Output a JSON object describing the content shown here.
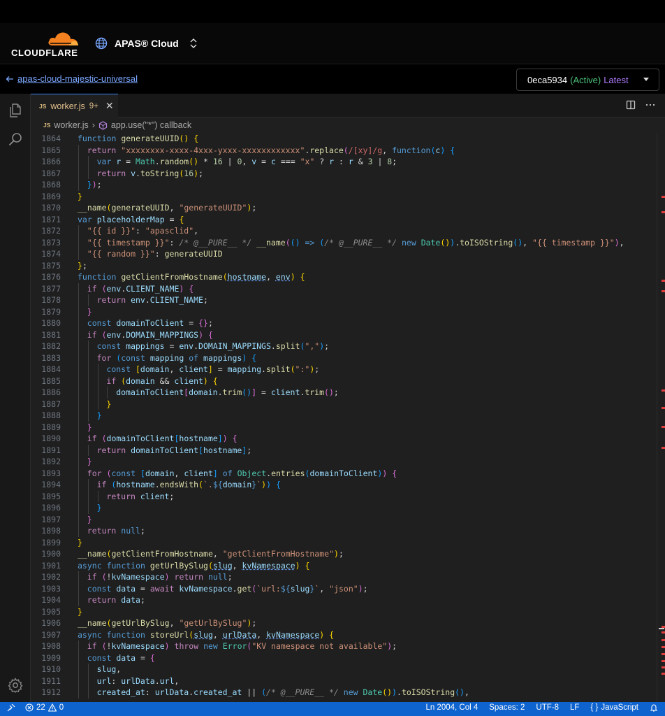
{
  "header": {
    "logo_text": "CLOUDFLARE",
    "app_name": "APAS® Cloud"
  },
  "subheader": {
    "back_label": "apas-cloud-majestic-universal",
    "version": {
      "hash": "0eca5934",
      "status": "(Active)",
      "tag": "Latest"
    }
  },
  "tab": {
    "badge": "JS",
    "name": "worker.js",
    "problems": "9+"
  },
  "breadcrumb": {
    "badge": "JS",
    "file": "worker.js",
    "symbol": "app.use(\"*\") callback"
  },
  "status": {
    "errors": "22",
    "warnings": "0",
    "position": "Ln 2004, Col 4",
    "spaces": "Spaces: 2",
    "encoding": "UTF-8",
    "eol": "LF",
    "language": "JavaScript"
  },
  "code": {
    "lines": [
      {
        "n": "1864",
        "i": 0,
        "h": "<span class=\"kw\">function</span> <span class=\"fn\">generateUUID</span><span class=\"bra1\">()</span> <span class=\"bra1\">{</span>"
      },
      {
        "n": "1865",
        "i": 1,
        "h": "<span class=\"ctl\">return</span> <span class=\"str\">\"xxxxxxxx-xxxx-4xxx-yxxx-xxxxxxxxxxxx\"</span>.<span class=\"fn\">replace</span><span class=\"bra2\">(</span><span class=\"rx\">/[xy]/g</span>, <span class=\"kw\">function</span><span class=\"bra3\">(</span><span class=\"var\">c</span><span class=\"bra3\">)</span> <span class=\"bra3\">{</span>"
      },
      {
        "n": "1866",
        "i": 2,
        "h": "<span class=\"kw\">var</span> <span class=\"var\">r</span> = <span class=\"typ\">Math</span>.<span class=\"fn\">random</span><span class=\"bra1\">()</span> * <span class=\"num\">16</span> | <span class=\"num\">0</span>, <span class=\"var\">v</span> = <span class=\"var\">c</span> === <span class=\"str\">\"x\"</span> ? <span class=\"var\">r</span> : <span class=\"var\">r</span> &amp; <span class=\"num\">3</span> | <span class=\"num\">8</span>;"
      },
      {
        "n": "1867",
        "i": 2,
        "h": "<span class=\"ctl\">return</span> <span class=\"var\">v</span>.<span class=\"fn\">toString</span><span class=\"bra1\">(</span><span class=\"num\">16</span><span class=\"bra1\">)</span>;"
      },
      {
        "n": "1868",
        "i": 1,
        "h": "<span class=\"bra3\">}</span><span class=\"bra2\">)</span>;"
      },
      {
        "n": "1869",
        "i": 0,
        "h": "<span class=\"bra1\">}</span>"
      },
      {
        "n": "1870",
        "i": 0,
        "h": "<span class=\"fn\">__name</span><span class=\"bra1\">(</span><span class=\"fn\">generateUUID</span>, <span class=\"str\">\"generateUUID\"</span><span class=\"bra1\">)</span>;"
      },
      {
        "n": "1871",
        "i": 0,
        "h": "<span class=\"kw\">var</span> <span class=\"var\">placeholderMap</span> = <span class=\"bra1\">{</span>"
      },
      {
        "n": "1872",
        "i": 1,
        "h": "<span class=\"str\">\"{{ id }}\"</span>: <span class=\"str\">\"apasclid\"</span>,"
      },
      {
        "n": "1873",
        "i": 1,
        "h": "<span class=\"str\">\"{{ timestamp }}\"</span>: <span class=\"cmt\">/* @__PURE__ */</span> <span class=\"fn\">__name</span><span class=\"bra2\">(</span><span class=\"bra3\">()</span> <span class=\"kw\">=&gt;</span> <span class=\"bra3\">(</span><span class=\"cmt\">/* @__PURE__ */</span> <span class=\"kw\">new</span> <span class=\"typ\">Date</span><span class=\"bra1\">()</span><span class=\"bra3\">)</span>.<span class=\"fn\">toISOString</span><span class=\"bra3\">()</span>, <span class=\"str\">\"{{ timestamp }}\"</span><span class=\"bra2\">)</span>,"
      },
      {
        "n": "1874",
        "i": 1,
        "h": "<span class=\"str\">\"{{ random }}\"</span>: <span class=\"fn\">generateUUID</span>"
      },
      {
        "n": "1875",
        "i": 0,
        "h": "<span class=\"bra1\">}</span>;"
      },
      {
        "n": "1876",
        "i": 0,
        "h": "<span class=\"kw\">function</span> <span class=\"fn\">getClientFromHostname</span><span class=\"bra1\">(</span><span class=\"var sq\">hostname</span>, <span class=\"var sq\">env</span><span class=\"bra1\">)</span> <span class=\"bra1\">{</span>"
      },
      {
        "n": "1877",
        "i": 1,
        "h": "<span class=\"ctl\">if</span> <span class=\"bra2\">(</span><span class=\"var\">env</span>.<span class=\"var\">CLIENT_NAME</span><span class=\"bra2\">)</span> <span class=\"bra2\">{</span>"
      },
      {
        "n": "1878",
        "i": 2,
        "h": "<span class=\"ctl\">return</span> <span class=\"var\">env</span>.<span class=\"var\">CLIENT_NAME</span>;"
      },
      {
        "n": "1879",
        "i": 1,
        "h": "<span class=\"bra2\">}</span>"
      },
      {
        "n": "1880",
        "i": 1,
        "h": "<span class=\"kw\">const</span> <span class=\"var\">domainToClient</span> = <span class=\"bra2\">{}</span>;"
      },
      {
        "n": "1881",
        "i": 1,
        "h": "<span class=\"ctl\">if</span> <span class=\"bra2\">(</span><span class=\"var\">env</span>.<span class=\"var\">DOMAIN_MAPPINGS</span><span class=\"bra2\">)</span> <span class=\"bra2\">{</span>"
      },
      {
        "n": "1882",
        "i": 2,
        "h": "<span class=\"kw\">const</span> <span class=\"var\">mappings</span> = <span class=\"var\">env</span>.<span class=\"var\">DOMAIN_MAPPINGS</span>.<span class=\"fn\">split</span><span class=\"bra3\">(</span><span class=\"str\">\",\"</span><span class=\"bra3\">)</span>;"
      },
      {
        "n": "1883",
        "i": 2,
        "h": "<span class=\"ctl\">for</span> <span class=\"bra3\">(</span><span class=\"kw\">const</span> <span class=\"var\">mapping</span> <span class=\"kw\">of</span> <span class=\"var\">mappings</span><span class=\"bra3\">)</span> <span class=\"bra3\">{</span>"
      },
      {
        "n": "1884",
        "i": 3,
        "h": "<span class=\"kw\">const</span> <span class=\"bra1\">[</span><span class=\"var\">domain</span>, <span class=\"var\">client</span><span class=\"bra1\">]</span> = <span class=\"var\">mapping</span>.<span class=\"fn\">split</span><span class=\"bra1\">(</span><span class=\"str\">\":\"</span><span class=\"bra1\">)</span>;"
      },
      {
        "n": "1885",
        "i": 3,
        "h": "<span class=\"ctl\">if</span> <span class=\"bra1\">(</span><span class=\"var\">domain</span> &amp;&amp; <span class=\"var\">client</span><span class=\"bra1\">)</span> <span class=\"bra1\">{</span>"
      },
      {
        "n": "1886",
        "i": 4,
        "h": "<span class=\"var\">domainToClient</span><span class=\"bra2\">[</span><span class=\"var\">domain</span>.<span class=\"fn\">trim</span><span class=\"bra3\">()</span><span class=\"bra2\">]</span> = <span class=\"var\">client</span>.<span class=\"fn\">trim</span><span class=\"bra2\">()</span>;"
      },
      {
        "n": "1887",
        "i": 3,
        "h": "<span class=\"bra1\">}</span>"
      },
      {
        "n": "1888",
        "i": 2,
        "h": "<span class=\"bra3\">}</span>"
      },
      {
        "n": "1889",
        "i": 1,
        "h": "<span class=\"bra2\">}</span>"
      },
      {
        "n": "1890",
        "i": 1,
        "h": "<span class=\"ctl\">if</span> <span class=\"bra2\">(</span><span class=\"var\">domainToClient</span><span class=\"bra3\">[</span><span class=\"var\">hostname</span><span class=\"bra3\">]</span><span class=\"bra2\">)</span> <span class=\"bra2\">{</span>"
      },
      {
        "n": "1891",
        "i": 2,
        "h": "<span class=\"ctl\">return</span> <span class=\"var\">domainToClient</span><span class=\"bra3\">[</span><span class=\"var\">hostname</span><span class=\"bra3\">]</span>;"
      },
      {
        "n": "1892",
        "i": 1,
        "h": "<span class=\"bra2\">}</span>"
      },
      {
        "n": "1893",
        "i": 1,
        "h": "<span class=\"ctl\">for</span> <span class=\"bra2\">(</span><span class=\"kw\">const</span> <span class=\"bra3\">[</span><span class=\"var\">domain</span>, <span class=\"var\">client</span><span class=\"bra3\">]</span> <span class=\"kw\">of</span> <span class=\"typ\">Object</span>.<span class=\"fn\">entries</span><span class=\"bra3\">(</span><span class=\"var\">domainToClient</span><span class=\"bra3\">)</span><span class=\"bra2\">)</span> <span class=\"bra2\">{</span>"
      },
      {
        "n": "1894",
        "i": 2,
        "h": "<span class=\"ctl\">if</span> <span class=\"bra3\">(</span><span class=\"var\">hostname</span>.<span class=\"fn\">endsWith</span><span class=\"bra1\">(</span><span class=\"str\">`.</span><span class=\"kw\">${</span><span class=\"var\">domain</span><span class=\"kw\">}</span><span class=\"str\">`</span><span class=\"bra1\">)</span><span class=\"bra3\">)</span> <span class=\"bra3\">{</span>"
      },
      {
        "n": "1895",
        "i": 3,
        "h": "<span class=\"ctl\">return</span> <span class=\"var\">client</span>;"
      },
      {
        "n": "1896",
        "i": 2,
        "h": "<span class=\"bra3\">}</span>"
      },
      {
        "n": "1897",
        "i": 1,
        "h": "<span class=\"bra2\">}</span>"
      },
      {
        "n": "1898",
        "i": 1,
        "h": "<span class=\"ctl\">return</span> <span class=\"kw\">null</span>;"
      },
      {
        "n": "1899",
        "i": 0,
        "h": "<span class=\"bra1\">}</span>"
      },
      {
        "n": "1900",
        "i": 0,
        "h": "<span class=\"fn\">__name</span><span class=\"bra1\">(</span><span class=\"fn\">getClientFromHostname</span>, <span class=\"str\">\"getClientFromHostname\"</span><span class=\"bra1\">)</span>;"
      },
      {
        "n": "1901",
        "i": 0,
        "h": "<span class=\"kw\">async</span> <span class=\"kw\">function</span> <span class=\"fn\">getUrlBySlug</span><span class=\"bra1\">(</span><span class=\"var sq\">slug</span>, <span class=\"var sq\">kvNamespace</span><span class=\"bra1\">)</span> <span class=\"bra1\">{</span>"
      },
      {
        "n": "1902",
        "i": 1,
        "h": "<span class=\"ctl\">if</span> <span class=\"bra2\">(</span>!<span class=\"var\">kvNamespace</span><span class=\"bra2\">)</span> <span class=\"ctl\">return</span> <span class=\"kw\">null</span>;"
      },
      {
        "n": "1903",
        "i": 1,
        "h": "<span class=\"kw\">const</span> <span class=\"var\">data</span> = <span class=\"ctl\">await</span> <span class=\"var\">kvNamespace</span>.<span class=\"fn\">get</span><span class=\"bra2\">(</span><span class=\"str\">`url:</span><span class=\"kw\">${</span><span class=\"var\">slug</span><span class=\"kw\">}</span><span class=\"str\">`</span>, <span class=\"str\">\"json\"</span><span class=\"bra2\">)</span>;"
      },
      {
        "n": "1904",
        "i": 1,
        "h": "<span class=\"ctl\">return</span> <span class=\"var\">data</span>;"
      },
      {
        "n": "1905",
        "i": 0,
        "h": "<span class=\"bra1\">}</span>"
      },
      {
        "n": "1906",
        "i": 0,
        "h": "<span class=\"fn\">__name</span><span class=\"bra1\">(</span><span class=\"fn\">getUrlBySlug</span>, <span class=\"str\">\"getUrlBySlug\"</span><span class=\"bra1\">)</span>;"
      },
      {
        "n": "1907",
        "i": 0,
        "h": "<span class=\"kw\">async</span> <span class=\"kw\">function</span> <span class=\"fn\">storeUrl</span><span class=\"bra1\">(</span><span class=\"var sq\">slug</span>, <span class=\"var sq\">urlData</span>, <span class=\"var sq\">kvNamespace</span><span class=\"bra1\">)</span> <span class=\"bra1\">{</span>"
      },
      {
        "n": "1908",
        "i": 1,
        "h": "<span class=\"ctl\">if</span> <span class=\"bra2\">(</span>!<span class=\"var\">kvNamespace</span><span class=\"bra2\">)</span> <span class=\"ctl\">throw</span> <span class=\"kw\">new</span> <span class=\"typ\">Error</span><span class=\"bra2\">(</span><span class=\"str\">\"KV namespace not available\"</span><span class=\"bra2\">)</span>;"
      },
      {
        "n": "1909",
        "i": 1,
        "h": "<span class=\"kw\">const</span> <span class=\"var\">data</span> = <span class=\"bra2\">{</span>"
      },
      {
        "n": "1910",
        "i": 2,
        "h": "<span class=\"var\">slug</span>,"
      },
      {
        "n": "1911",
        "i": 2,
        "h": "<span class=\"var\">url</span>: <span class=\"var\">urlData</span>.<span class=\"var\">url</span>,"
      },
      {
        "n": "1912",
        "i": 2,
        "h": "<span class=\"var\">created_at</span>: <span class=\"var\">urlData</span>.<span class=\"var\">created_at</span> || <span class=\"bra3\">(</span><span class=\"cmt\">/* @__PURE__ */</span> <span class=\"kw\">new</span> <span class=\"typ\">Date</span><span class=\"bra1\">()</span><span class=\"bra3\">)</span>.<span class=\"fn\">toISOString</span><span class=\"bra3\">()</span>,"
      }
    ]
  },
  "scrollbar_marks": [
    0.111,
    0.137,
    0.258,
    0.277,
    0.451,
    0.482,
    0.515,
    0.552,
    0.866,
    0.876,
    0.889,
    0.902,
    0.914,
    0.926,
    0.937,
    0.949
  ]
}
